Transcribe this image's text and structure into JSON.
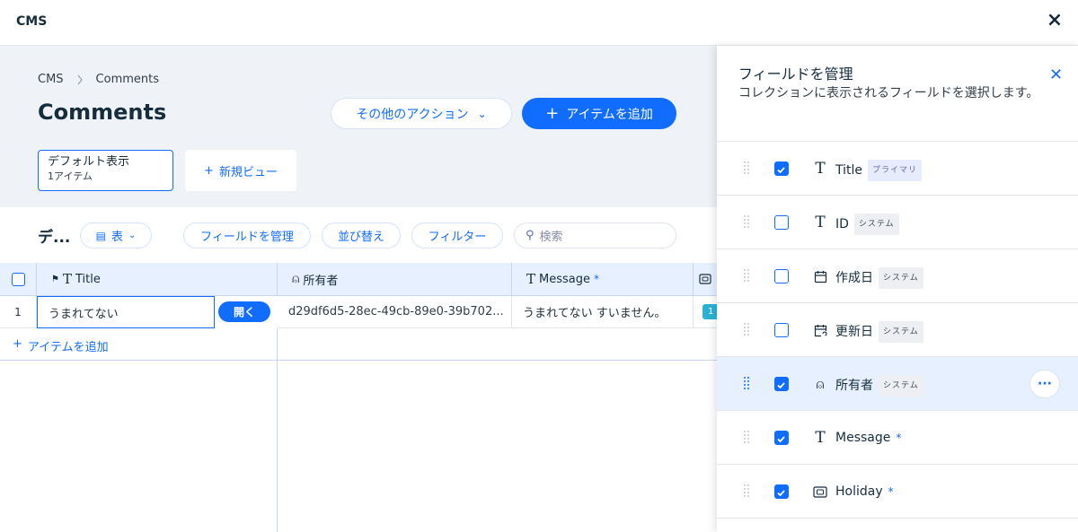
{
  "app": {
    "title": "CMS",
    "close": "×"
  },
  "breadcrumb": {
    "root": "CMS",
    "current": "Comments"
  },
  "page": {
    "title": "Comments"
  },
  "actions": {
    "more_label": "その他のアクション",
    "more_caret": "⌄",
    "add_plus": "+",
    "add_label": "アイテムを追加"
  },
  "views": {
    "default_name": "デフォルト表示",
    "default_count": "1アイテム",
    "new_plus": "+",
    "new_label": "新規ビュー"
  },
  "toolbar": {
    "title": "デ...",
    "table_icon": "▤",
    "table_label": "表",
    "table_caret": "⌄",
    "manage_fields": "フィールドを管理",
    "sort": "並び替え",
    "filter": "フィルター",
    "search_icon": "⚲",
    "search_placeholder": "検索"
  },
  "table": {
    "columns": [
      {
        "flag": "⚑",
        "icon": "T",
        "label": "Title"
      },
      {
        "icon": "⍝",
        "label": "所有者"
      },
      {
        "icon": "T",
        "label": "Message",
        "required": "*"
      }
    ],
    "rows": [
      {
        "index": "1",
        "title": "うまれてない",
        "open_label": "開く",
        "owner": "d29df6d5-28ec-49cb-89e0-39b702...",
        "message": "うまれてない すいません。",
        "holiday_badge": "1"
      }
    ],
    "add_plus": "+",
    "add_label": "アイテムを追加"
  },
  "panel": {
    "title": "フィールドを管理",
    "description": "コレクションに表示されるフィールドを選択します。",
    "close": "✕",
    "fields": [
      {
        "label": "Title",
        "icon": "T",
        "tag": "プライマリ",
        "checked": true
      },
      {
        "label": "ID",
        "icon": "T",
        "tag": "システム",
        "checked": false
      },
      {
        "label": "作成日",
        "icon": "▦",
        "tag": "システム",
        "checked": false
      },
      {
        "label": "更新日",
        "icon": "▧",
        "tag": "システム",
        "checked": false
      },
      {
        "label": "所有者",
        "icon": "⍝",
        "tag": "システム",
        "checked": true,
        "active": true,
        "more": "···"
      },
      {
        "label": "Message",
        "icon": "T",
        "required": "*",
        "checked": true
      },
      {
        "label": "Holiday",
        "icon": "▣",
        "required": "*",
        "checked": true
      }
    ]
  },
  "colors": {
    "accent": "#116dff",
    "header_bg": "#eff2f6",
    "selected_bg": "#e7f0ff"
  }
}
